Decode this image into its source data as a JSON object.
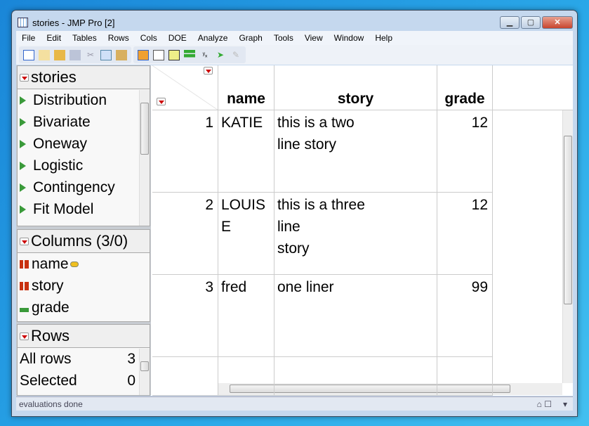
{
  "window": {
    "title": "stories - JMP Pro [2]",
    "minimize": "▁",
    "maximize": "▢",
    "close": "✕"
  },
  "menu": [
    "File",
    "Edit",
    "Tables",
    "Rows",
    "Cols",
    "DOE",
    "Analyze",
    "Graph",
    "Tools",
    "View",
    "Window",
    "Help"
  ],
  "toolbar": {
    "icons1": [
      "new-data-table-icon",
      "new-script-icon",
      "open-icon",
      "save-icon",
      "cut-icon",
      "copy-icon",
      "paste-icon"
    ],
    "icons2": [
      "data-table-icon",
      "table-icon",
      "grid-icon",
      "distribution-icon",
      "fit-y-by-x-icon",
      "fit-model-icon",
      "edit-icon"
    ]
  },
  "table_panel": {
    "title": "stories",
    "items": [
      "Distribution",
      "Bivariate",
      "Oneway",
      "Logistic",
      "Contingency",
      "Fit Model"
    ]
  },
  "columns_panel": {
    "title": "Columns (3/0)",
    "columns": [
      {
        "name": "name",
        "type": "nominal"
      },
      {
        "name": "story",
        "type": "nominal"
      },
      {
        "name": "grade",
        "type": "continuous"
      }
    ]
  },
  "rows_panel": {
    "title": "Rows",
    "rows": [
      {
        "label": "All rows",
        "value": "3"
      },
      {
        "label": "Selected",
        "value": "0"
      }
    ]
  },
  "grid": {
    "headers": [
      "name",
      "story",
      "grade"
    ],
    "rows": [
      {
        "num": "1",
        "name": "KATIE",
        "story": [
          "this is a two",
          "line story"
        ],
        "grade": "12"
      },
      {
        "num": "2",
        "name": [
          "LOUIS",
          "E"
        ],
        "story": [
          "this is a three",
          "line",
          "story"
        ],
        "grade": "12"
      },
      {
        "num": "3",
        "name": "fred",
        "story": [
          "one liner"
        ],
        "grade": "99"
      }
    ]
  },
  "status": {
    "text": "evaluations done"
  },
  "colors": {
    "accent_red": "#cc0000",
    "nominal": "#c83010",
    "continuous": "#3a9a3a"
  }
}
